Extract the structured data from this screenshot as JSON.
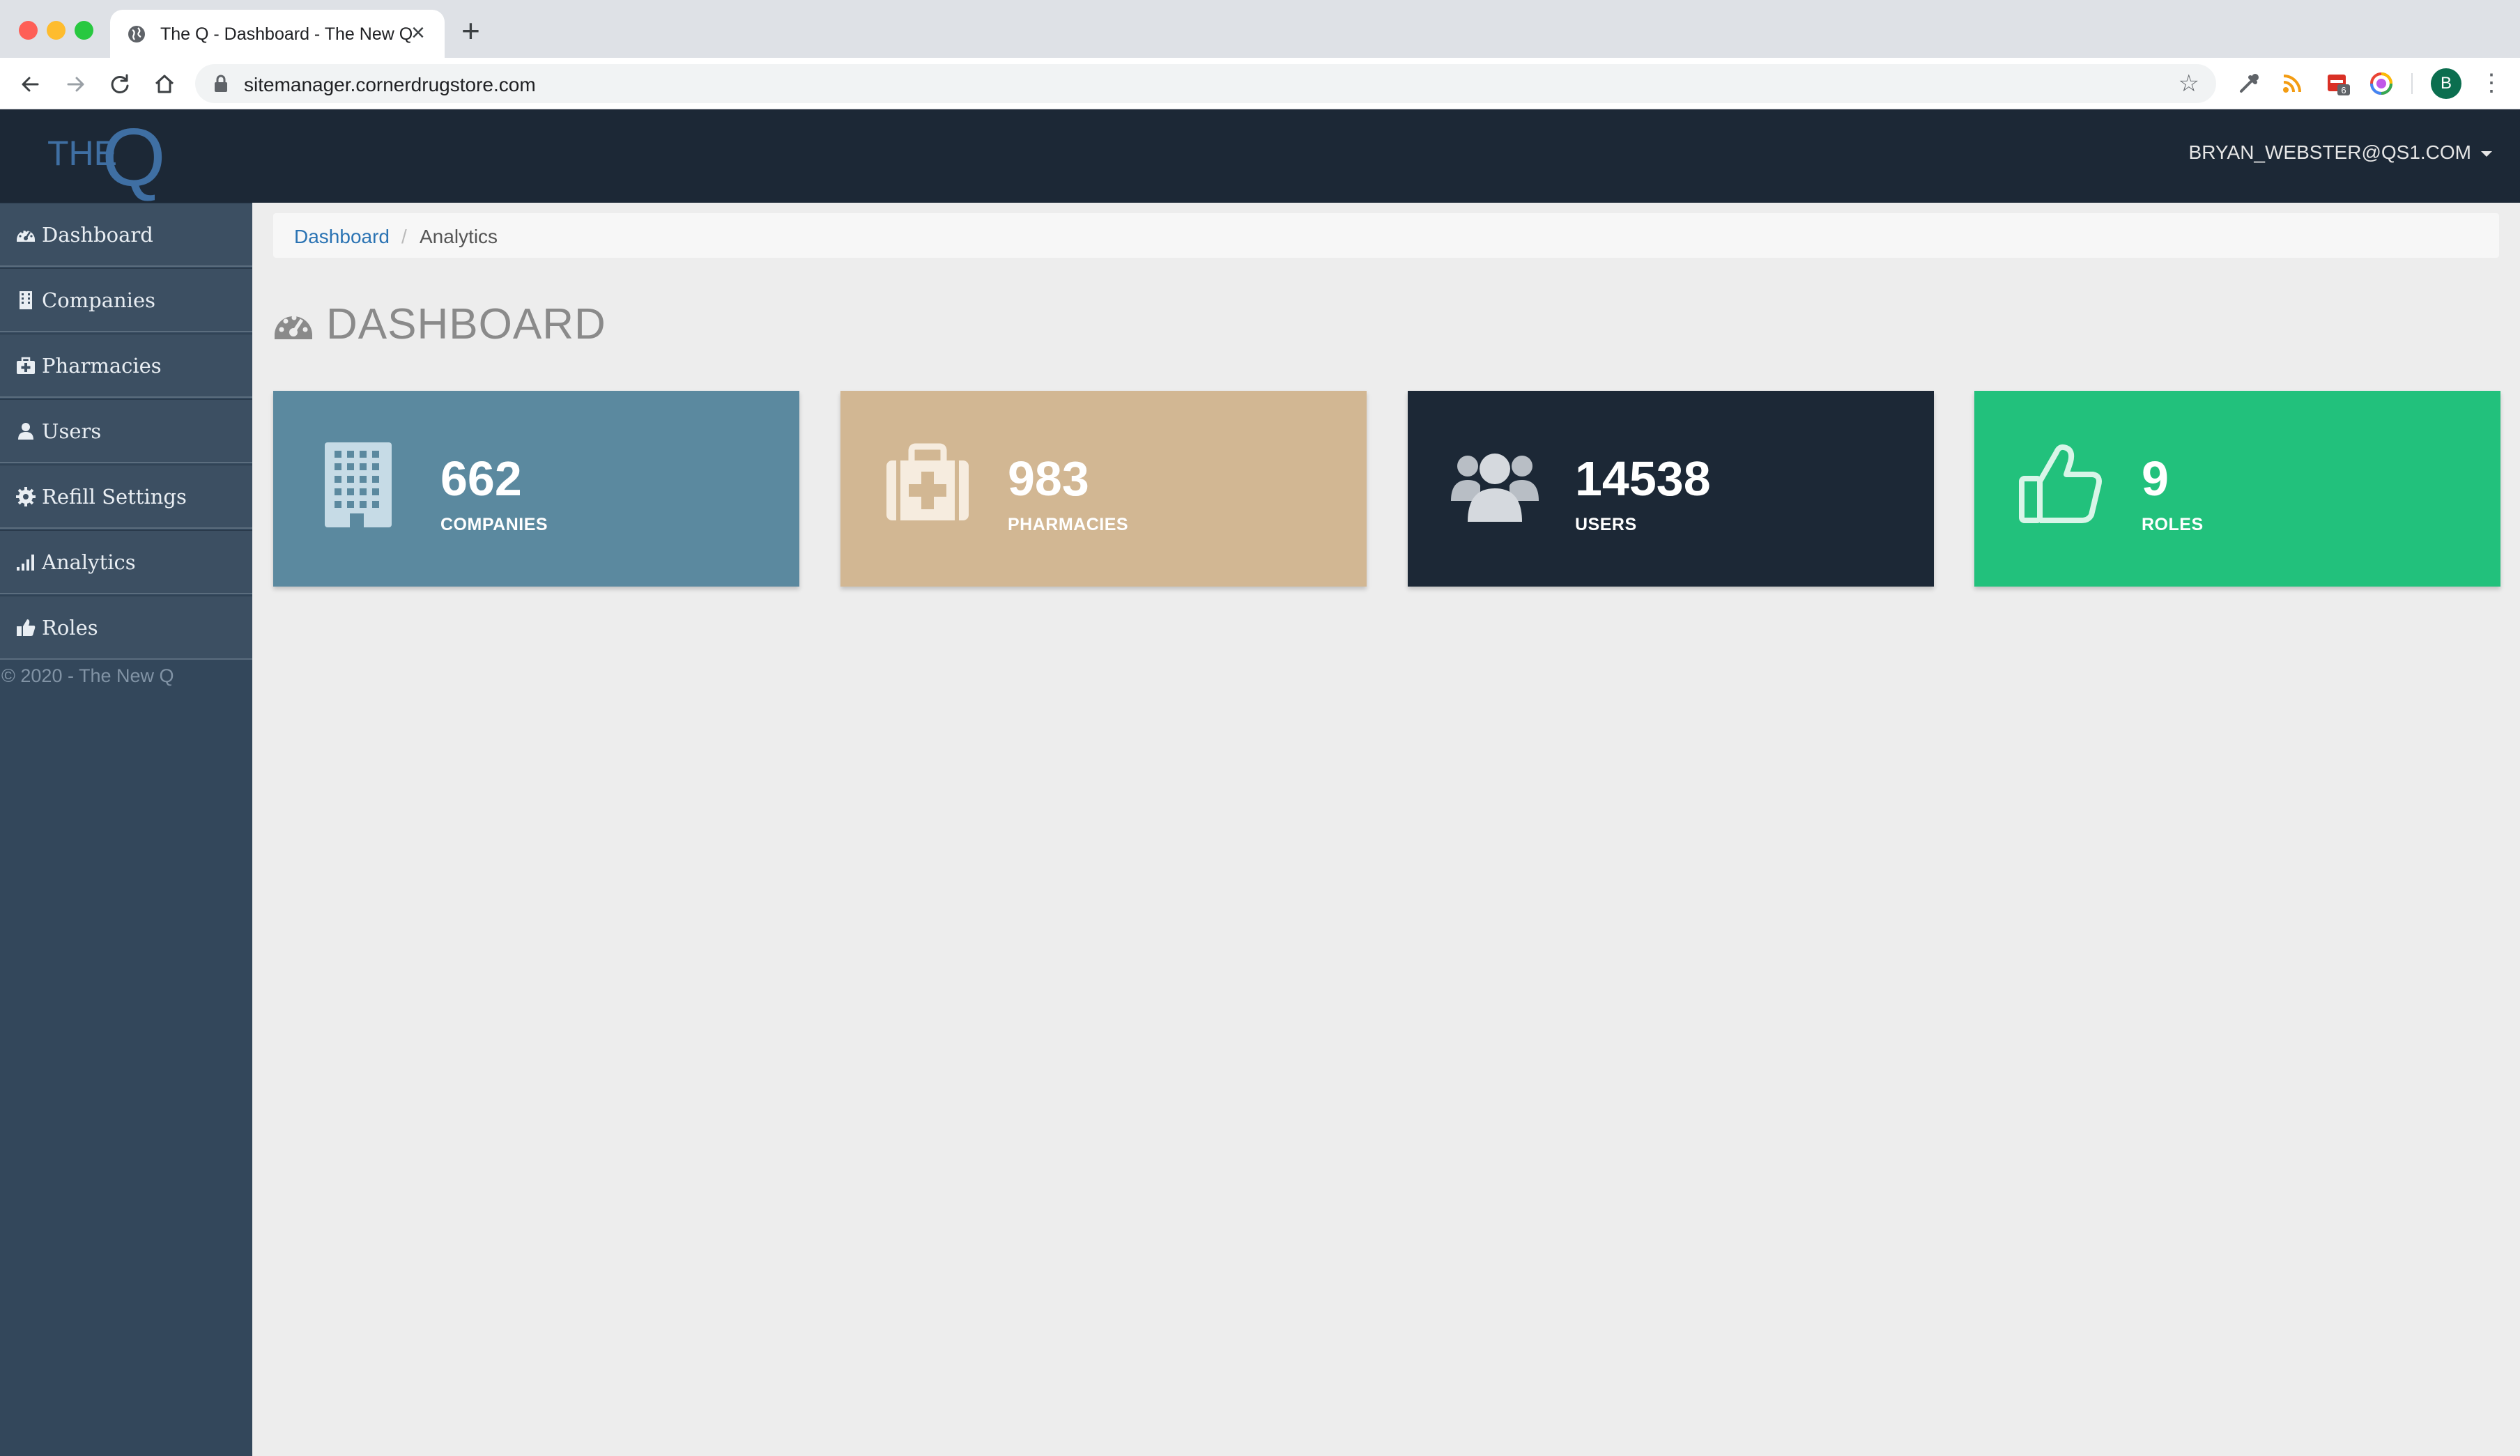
{
  "browser": {
    "tab_title": "The Q - Dashboard - The New Q",
    "new_tab_symbol": "+",
    "url": "sitemanager.cornerdrugstore.com",
    "profile_initial": "B",
    "calendar_badge": "6"
  },
  "header": {
    "logo_the": "THE",
    "logo_q": "Q",
    "user": "BRYAN_WEBSTER@QS1.COM"
  },
  "sidebar": {
    "items": [
      {
        "label": "Dashboard",
        "icon": "dashboard-icon"
      },
      {
        "label": "Companies",
        "icon": "building-icon"
      },
      {
        "label": "Pharmacies",
        "icon": "medkit-icon"
      },
      {
        "label": "Users",
        "icon": "user-icon"
      },
      {
        "label": "Refill Settings",
        "icon": "gear-icon"
      },
      {
        "label": "Analytics",
        "icon": "signal-bars-icon"
      },
      {
        "label": "Roles",
        "icon": "thumbs-up-icon"
      }
    ],
    "copyright": "© 2020 - The New Q"
  },
  "breadcrumb": {
    "link": "Dashboard",
    "separator": "/",
    "current": "Analytics"
  },
  "page": {
    "title": "DASHBOARD"
  },
  "cards": [
    {
      "value": "662",
      "label": "COMPANIES",
      "color": "#5b899f",
      "icon": "building-icon"
    },
    {
      "value": "983",
      "label": "PHARMACIES",
      "color": "#d2b793",
      "icon": "medkit-icon"
    },
    {
      "value": "14538",
      "label": "USERS",
      "color": "#1c2836",
      "icon": "users-icon"
    },
    {
      "value": "9",
      "label": "ROLES",
      "color": "#22c17c",
      "icon": "thumbs-up-icon"
    }
  ]
}
